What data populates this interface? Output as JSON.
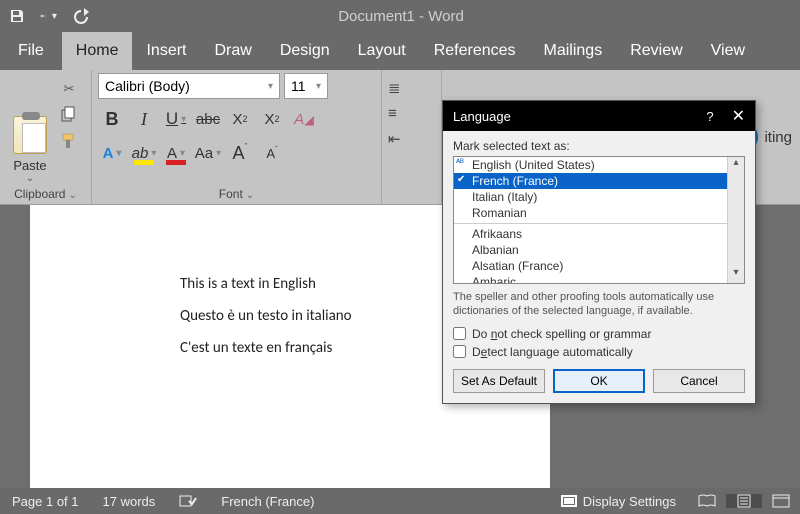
{
  "app": {
    "title": "Document1  -  Word"
  },
  "qat": {
    "save": "save-icon",
    "undo": "undo-icon",
    "redo": "redo-icon"
  },
  "tabs": [
    "File",
    "Home",
    "Insert",
    "Draw",
    "Design",
    "Layout",
    "References",
    "Mailings",
    "Review",
    "View"
  ],
  "active_tab": "Home",
  "ribbon": {
    "clipboard": {
      "label": "Clipboard",
      "paste": "Paste"
    },
    "font": {
      "label": "Font",
      "name": "Calibri (Body)",
      "size": "11",
      "btns2": {
        "bold": "B",
        "italic": "I",
        "underline": "U",
        "strike": "abc",
        "sub": "X",
        "sup": "X",
        "clear": "A"
      },
      "btns3": {
        "textfx": "A",
        "highlight": "ab",
        "color": "A",
        "case": "Aa",
        "grow": "A",
        "shrink": "A"
      }
    },
    "editing_fragment": "iting"
  },
  "document": {
    "lines": [
      "This is a text in English",
      "Questo è un testo in italiano",
      "C'est un texte en français"
    ]
  },
  "dialog": {
    "title": "Language",
    "mark_label": "Mark selected text as:",
    "langs": [
      {
        "name": "English (United States)",
        "chk": true,
        "top": true
      },
      {
        "name": "French (France)",
        "chk": true,
        "sel": true
      },
      {
        "name": "Italian (Italy)"
      },
      {
        "name": "Romanian"
      },
      {
        "name": "Afrikaans"
      },
      {
        "name": "Albanian"
      },
      {
        "name": "Alsatian (France)"
      },
      {
        "name": "Amharic"
      }
    ],
    "hint": "The speller and other proofing tools automatically use dictionaries of the selected language, if available.",
    "cb1": "Do not check spelling or grammar",
    "cb2": "Detect language automatically",
    "btn_default": "Set As Default",
    "btn_ok": "OK",
    "btn_cancel": "Cancel"
  },
  "status": {
    "page": "Page 1 of 1",
    "words": "17 words",
    "lang": "French (France)",
    "display": "Display Settings"
  }
}
